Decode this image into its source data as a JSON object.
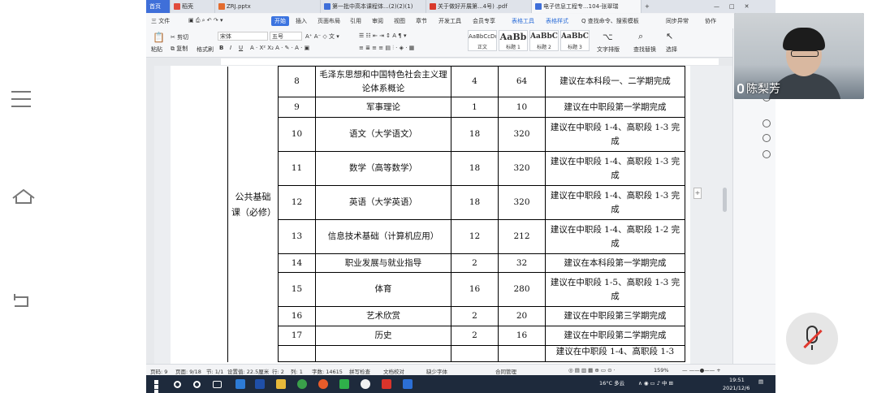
{
  "tabs": [
    {
      "label": "首页",
      "kind": "home"
    },
    {
      "label": "稻壳",
      "kind": "normal",
      "color": "#e14b3b"
    },
    {
      "label": "ZRJ.pptx",
      "kind": "normal",
      "color": "#e36c2f"
    },
    {
      "label": "第一批中高本课程体...(2)(2)(1)",
      "kind": "normal",
      "color": "#3f6fd9"
    },
    {
      "label": "关于做好开展第...4号) .pdf",
      "kind": "normal",
      "color": "#d8392b"
    },
    {
      "label": "电子信息工程专...104-张翠瑞",
      "kind": "active",
      "color": "#3f6fd9"
    }
  ],
  "menubar": {
    "file": "三 文件",
    "start": "开始",
    "items": [
      "插入",
      "页面布局",
      "引用",
      "审阅",
      "视图",
      "章节",
      "开发工具",
      "会员专享",
      "表格工具",
      "表格样式"
    ],
    "search": "Q 查找命令、搜索模板",
    "sync": "同步异常",
    "collab": "协作"
  },
  "ribbon": {
    "paste": "粘贴",
    "cut": "剪切",
    "copy": "复制",
    "format_painter": "格式刷",
    "font": "宋体",
    "size": "五号",
    "styles": [
      {
        "preview": "AaBbCcDd",
        "name": "正文"
      },
      {
        "preview": "AaBb",
        "name": "标题 1"
      },
      {
        "preview": "AaBbC",
        "name": "标题 2"
      },
      {
        "preview": "AaBbC",
        "name": "标题 3"
      }
    ],
    "text_layout": "文字排版",
    "find_replace": "查找替换",
    "select": "选择"
  },
  "table": {
    "category": "公共基础课（必修）",
    "rows": [
      {
        "no": "8",
        "course": "毛泽东思想和中国特色社会主义理论体系概论",
        "credits": "4",
        "hours": "64",
        "note": "建议在本科段一、二学期完成"
      },
      {
        "no": "9",
        "course": "军事理论",
        "credits": "1",
        "hours": "10",
        "note": "建议在中职段第一学期完成"
      },
      {
        "no": "10",
        "course": "语文（大学语文）",
        "credits": "18",
        "hours": "320",
        "note": "建议在中职段 1-4、高职段 1-3 完成"
      },
      {
        "no": "11",
        "course": "数学（高等数学）",
        "credits": "18",
        "hours": "320",
        "note": "建议在中职段 1-4、高职段 1-3 完成"
      },
      {
        "no": "12",
        "course": "英语（大学英语）",
        "credits": "18",
        "hours": "320",
        "note": "建议在中职段 1-4、高职段 1-3 完成"
      },
      {
        "no": "13",
        "course": "信息技术基础（计算机应用）",
        "credits": "12",
        "hours": "212",
        "note": "建议在中职段 1-4、高职段 1-2 完成"
      },
      {
        "no": "14",
        "course": "职业发展与就业指导",
        "credits": "2",
        "hours": "32",
        "note": "建议在本科段第一学期完成"
      },
      {
        "no": "15",
        "course": "体育",
        "credits": "16",
        "hours": "280",
        "note": "建议在中职段 1-5、高职段 1-3 完成"
      },
      {
        "no": "16",
        "course": "艺术欣赏",
        "credits": "2",
        "hours": "20",
        "note": "建议在中职段第三学期完成"
      },
      {
        "no": "17",
        "course": "历史",
        "credits": "2",
        "hours": "16",
        "note": "建议在中职段第二学期完成"
      },
      {
        "no": "",
        "course": "",
        "credits": "",
        "hours": "",
        "note": "建议在中职段 1-4、高职段 1-3"
      }
    ]
  },
  "statusbar": {
    "page": "页码: 9",
    "pages": "页面: 9/18",
    "section": "节: 1/1",
    "position": "设置值: 22.5厘米",
    "row": "行: 2",
    "col": "列: 1",
    "words": "字数: 14615",
    "spell": "拼写检查",
    "proof": "文档校对",
    "missing_font": "缺少字体",
    "compliance": "合同管理",
    "zoom": "159%"
  },
  "taskbar": {
    "weather": "16°C 多云",
    "time": "19:51",
    "date": "2021/12/6"
  },
  "video": {
    "speaker_name": "陈梨芳"
  }
}
